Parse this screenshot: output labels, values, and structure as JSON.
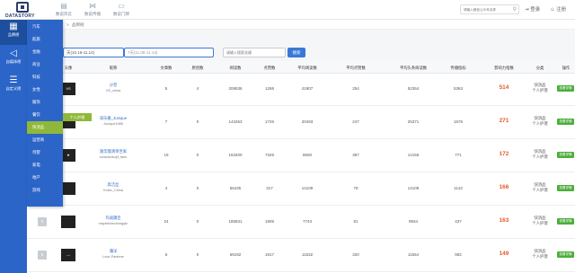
{
  "brand": {
    "name": "DATASTORY"
  },
  "topnav": [
    {
      "label": "数说风云",
      "icon": "book-icon"
    },
    {
      "label": "数说传播",
      "icon": "network-icon"
    },
    {
      "label": "数说门牌",
      "icon": "doorplate-icon"
    }
  ],
  "search": {
    "placeholder": "请输入微信公众号名称"
  },
  "toplinks": {
    "login": "登录",
    "register": "注册"
  },
  "leftbar": [
    {
      "label": "品牌榜",
      "icon": "chart-icon"
    },
    {
      "label": "自媒体榜",
      "icon": "speaker-icon"
    },
    {
      "label": "自定义榜",
      "icon": "list-icon"
    }
  ],
  "breadcrumb": {
    "sep": ">",
    "current": "品牌榜"
  },
  "filters": {
    "date_start": "天(10.16-11.14)",
    "date_end": "7天(11.08-11.14)",
    "keyword_placeholder": "请输入搜索关键",
    "search_button": "搜索"
  },
  "dropdown": [
    "汽车",
    "航旅",
    "金融",
    "商业",
    "科技",
    "女性",
    "服饰",
    "餐饮",
    "快消品",
    "运营商",
    "母婴",
    "家电",
    "地产",
    "游戏"
  ],
  "dropdown_active": "快消品",
  "flyout": "个人护理",
  "table": {
    "headers": [
      "头像",
      "昵称",
      "文章数",
      "原创数",
      "阅读数",
      "点赞数",
      "平均阅读数",
      "平均点赞数",
      "平均头条阅读数",
      "传播指标",
      "影响力指数",
      "分类",
      "操作"
    ],
    "rows": [
      {
        "no": "",
        "avatar": "VS",
        "name": "沙宣",
        "account": "VS_china",
        "articles": "5",
        "original": "4",
        "reads": "209536",
        "likes": "1268",
        "avg_reads": "41907",
        "avg_likes": "254",
        "avg_headline_reads": "52364",
        "spread": "5363",
        "influence": "514",
        "category_a": "快消品",
        "category_b": "个人护理",
        "action": "查看详情"
      },
      {
        "no": "",
        "avatar": "",
        "name": "采乐嘉_Junique",
        "account": "Junique1985",
        "articles": "7",
        "original": "0",
        "reads": "143453",
        "likes": "1726",
        "avg_reads": "20493",
        "avg_likes": "247",
        "avg_headline_reads": "25371",
        "spread": "1676",
        "influence": "271",
        "category_a": "快消品",
        "category_b": "个人护理",
        "action": "查看详情"
      },
      {
        "no": "",
        "avatar": "★",
        "name": "施华蔻清单世家",
        "account": "schwarzkopf_fans",
        "articles": "19",
        "original": "0",
        "reads": "163400",
        "likes": "7349",
        "avg_reads": "8600",
        "avg_likes": "387",
        "avg_headline_reads": "14156",
        "spread": "771",
        "influence": "172",
        "category_a": "快消品",
        "category_b": "个人护理",
        "action": "查看详情"
      },
      {
        "no": "4",
        "avatar": "",
        "name": "高洁丝",
        "account": "Kotex_China",
        "articles": "4",
        "original": "0",
        "reads": "56435",
        "likes": "317",
        "avg_reads": "14109",
        "avg_likes": "79",
        "avg_headline_reads": "14109",
        "spread": "1142",
        "influence": "166",
        "category_a": "快消品",
        "category_b": "个人护理",
        "action": "查看详情"
      },
      {
        "no": "5",
        "avatar": "",
        "name": "玛丽黛佳",
        "account": "maybelinechongqin",
        "articles": "24",
        "original": "0",
        "reads": "185831",
        "likes": "1905",
        "avg_reads": "7743",
        "avg_likes": "81",
        "avg_headline_reads": "9834",
        "spread": "437",
        "influence": "163",
        "category_a": "快消品",
        "category_b": "个人护理",
        "action": "查看详情"
      },
      {
        "no": "6",
        "avatar": "—",
        "name": "蒲洋",
        "account": "Love-Pantene",
        "articles": "6",
        "original": "0",
        "reads": "69192",
        "likes": "1917",
        "avg_reads": "11532",
        "avg_likes": "320",
        "avg_headline_reads": "11554",
        "spread": "982",
        "influence": "149",
        "category_a": "快消品",
        "category_b": "个人护理",
        "action": "查看详情"
      }
    ]
  }
}
